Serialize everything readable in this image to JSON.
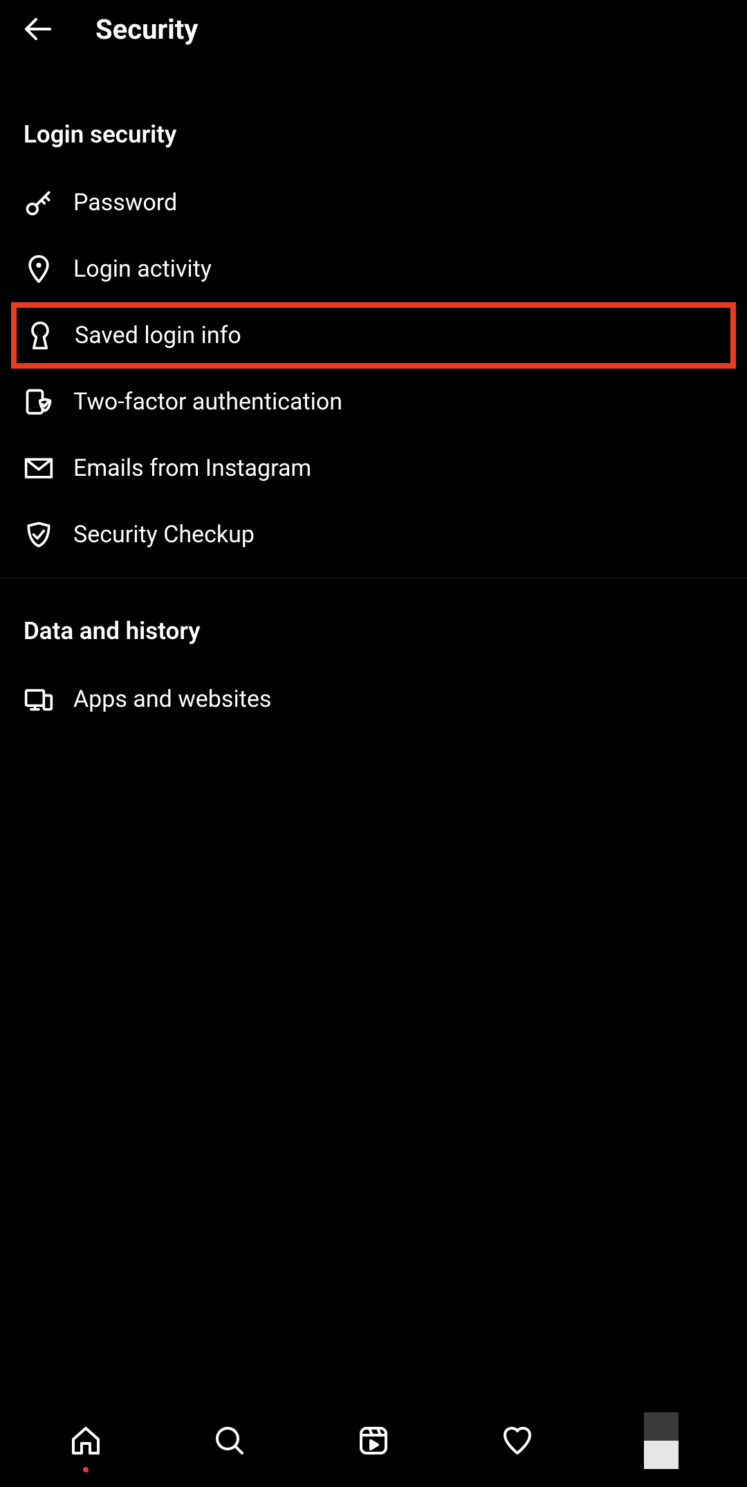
{
  "header": {
    "title": "Security"
  },
  "sections": [
    {
      "title": "Login security",
      "items": [
        {
          "label": "Password"
        },
        {
          "label": "Login activity"
        },
        {
          "label": "Saved login info"
        },
        {
          "label": "Two-factor authentication"
        },
        {
          "label": "Emails from Instagram"
        },
        {
          "label": "Security Checkup"
        }
      ]
    },
    {
      "title": "Data and history",
      "items": [
        {
          "label": "Apps and websites"
        }
      ]
    }
  ]
}
